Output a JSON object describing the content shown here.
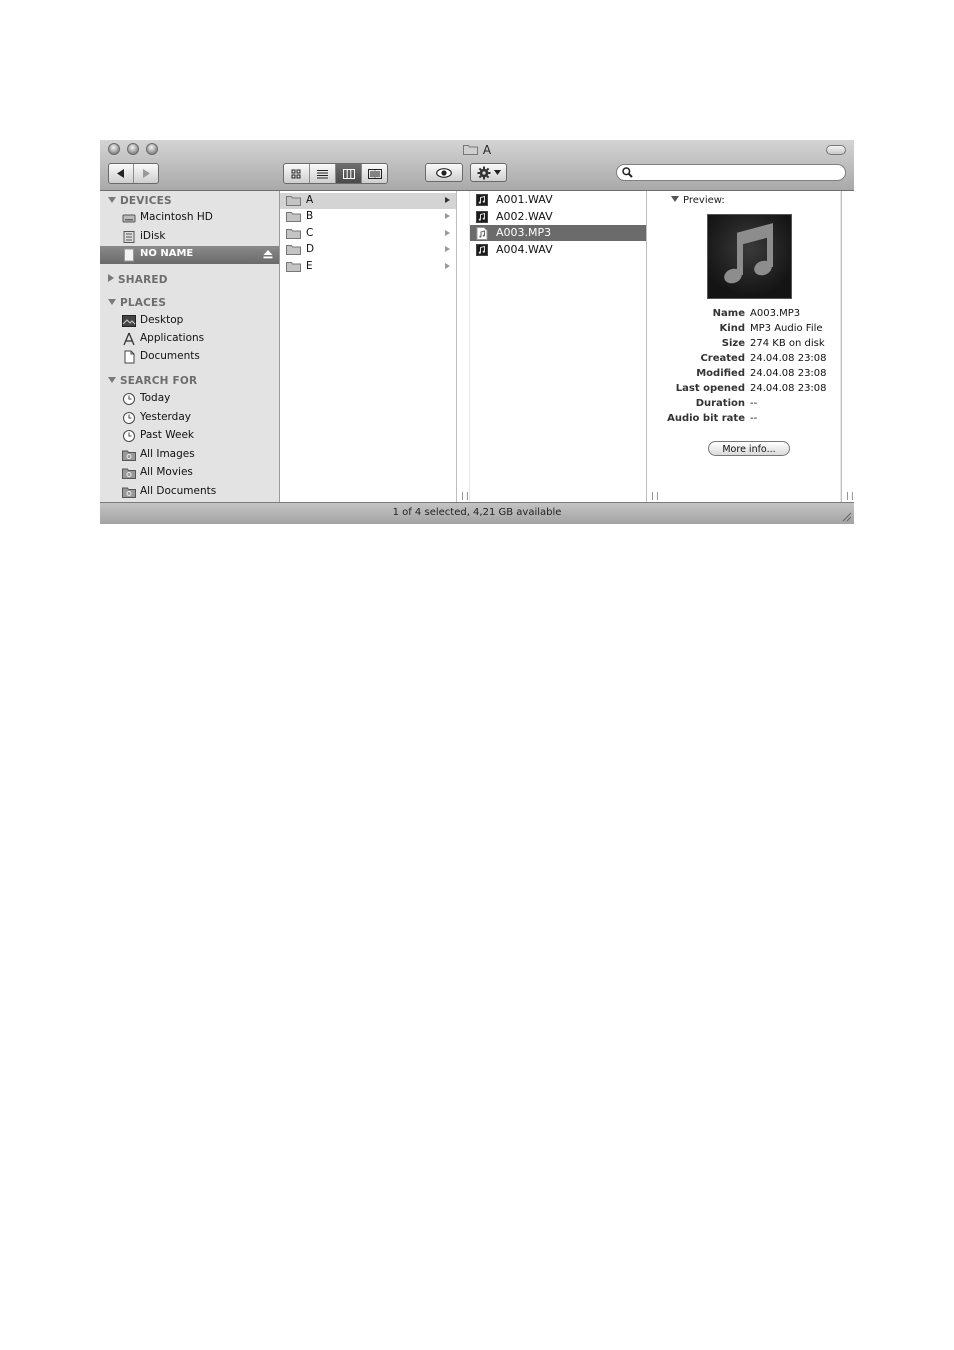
{
  "window": {
    "title": "A",
    "colors": {
      "selection_dark": "#6b6b6b",
      "selection_gray": "#d4d4d4",
      "sidebar_bg": "#e3e3e3"
    }
  },
  "toolbar": {
    "back_icon": "back-arrow-icon",
    "forward_icon": "forward-arrow-icon",
    "views": [
      "icon-view-icon",
      "list-view-icon",
      "column-view-icon",
      "coverflow-view-icon"
    ],
    "active_view": "column",
    "quicklook_icon": "eye-icon",
    "action_icon": "gear-icon",
    "search": {
      "value": "",
      "placeholder": ""
    }
  },
  "sidebar": {
    "devices": {
      "header": "DEVICES",
      "items": [
        {
          "label": "Macintosh HD",
          "icon": "hard-drive-icon"
        },
        {
          "label": "iDisk",
          "icon": "idisk-icon"
        },
        {
          "label": "NO NAME",
          "icon": "removable-disk-icon",
          "selected": true
        }
      ]
    },
    "shared": {
      "header": "SHARED"
    },
    "places": {
      "header": "PLACES",
      "items": [
        {
          "label": "Desktop",
          "icon": "desktop-icon"
        },
        {
          "label": "Applications",
          "icon": "applications-icon"
        },
        {
          "label": "Documents",
          "icon": "documents-icon"
        }
      ]
    },
    "search_for": {
      "header": "SEARCH FOR",
      "items": [
        {
          "label": "Today",
          "icon": "clock-icon"
        },
        {
          "label": "Yesterday",
          "icon": "clock-icon"
        },
        {
          "label": "Past Week",
          "icon": "clock-icon"
        },
        {
          "label": "All Images",
          "icon": "smart-folder-icon"
        },
        {
          "label": "All Movies",
          "icon": "smart-folder-icon"
        },
        {
          "label": "All Documents",
          "icon": "smart-folder-icon"
        }
      ]
    }
  },
  "columns": {
    "folders": [
      "A",
      "B",
      "C",
      "D",
      "E"
    ],
    "files": [
      "A001.WAV",
      "A002.WAV",
      "A003.MP3",
      "A004.WAV"
    ]
  },
  "preview": {
    "header": "Preview:",
    "icon": "music-note-icon",
    "info": [
      {
        "key": "Name",
        "value": "A003.MP3"
      },
      {
        "key": "Kind",
        "value": "MP3 Audio File"
      },
      {
        "key": "Size",
        "value": "274 KB on disk"
      },
      {
        "key": "Created",
        "value": "24.04.08 23:08"
      },
      {
        "key": "Modified",
        "value": "24.04.08 23:08"
      },
      {
        "key": "Last opened",
        "value": "24.04.08 23:08"
      },
      {
        "key": "Duration",
        "value": "--"
      },
      {
        "key": "Audio bit rate",
        "value": "--"
      }
    ],
    "more_info": "More info..."
  },
  "status": {
    "text": "1 of 4 selected, 4,21 GB available"
  }
}
